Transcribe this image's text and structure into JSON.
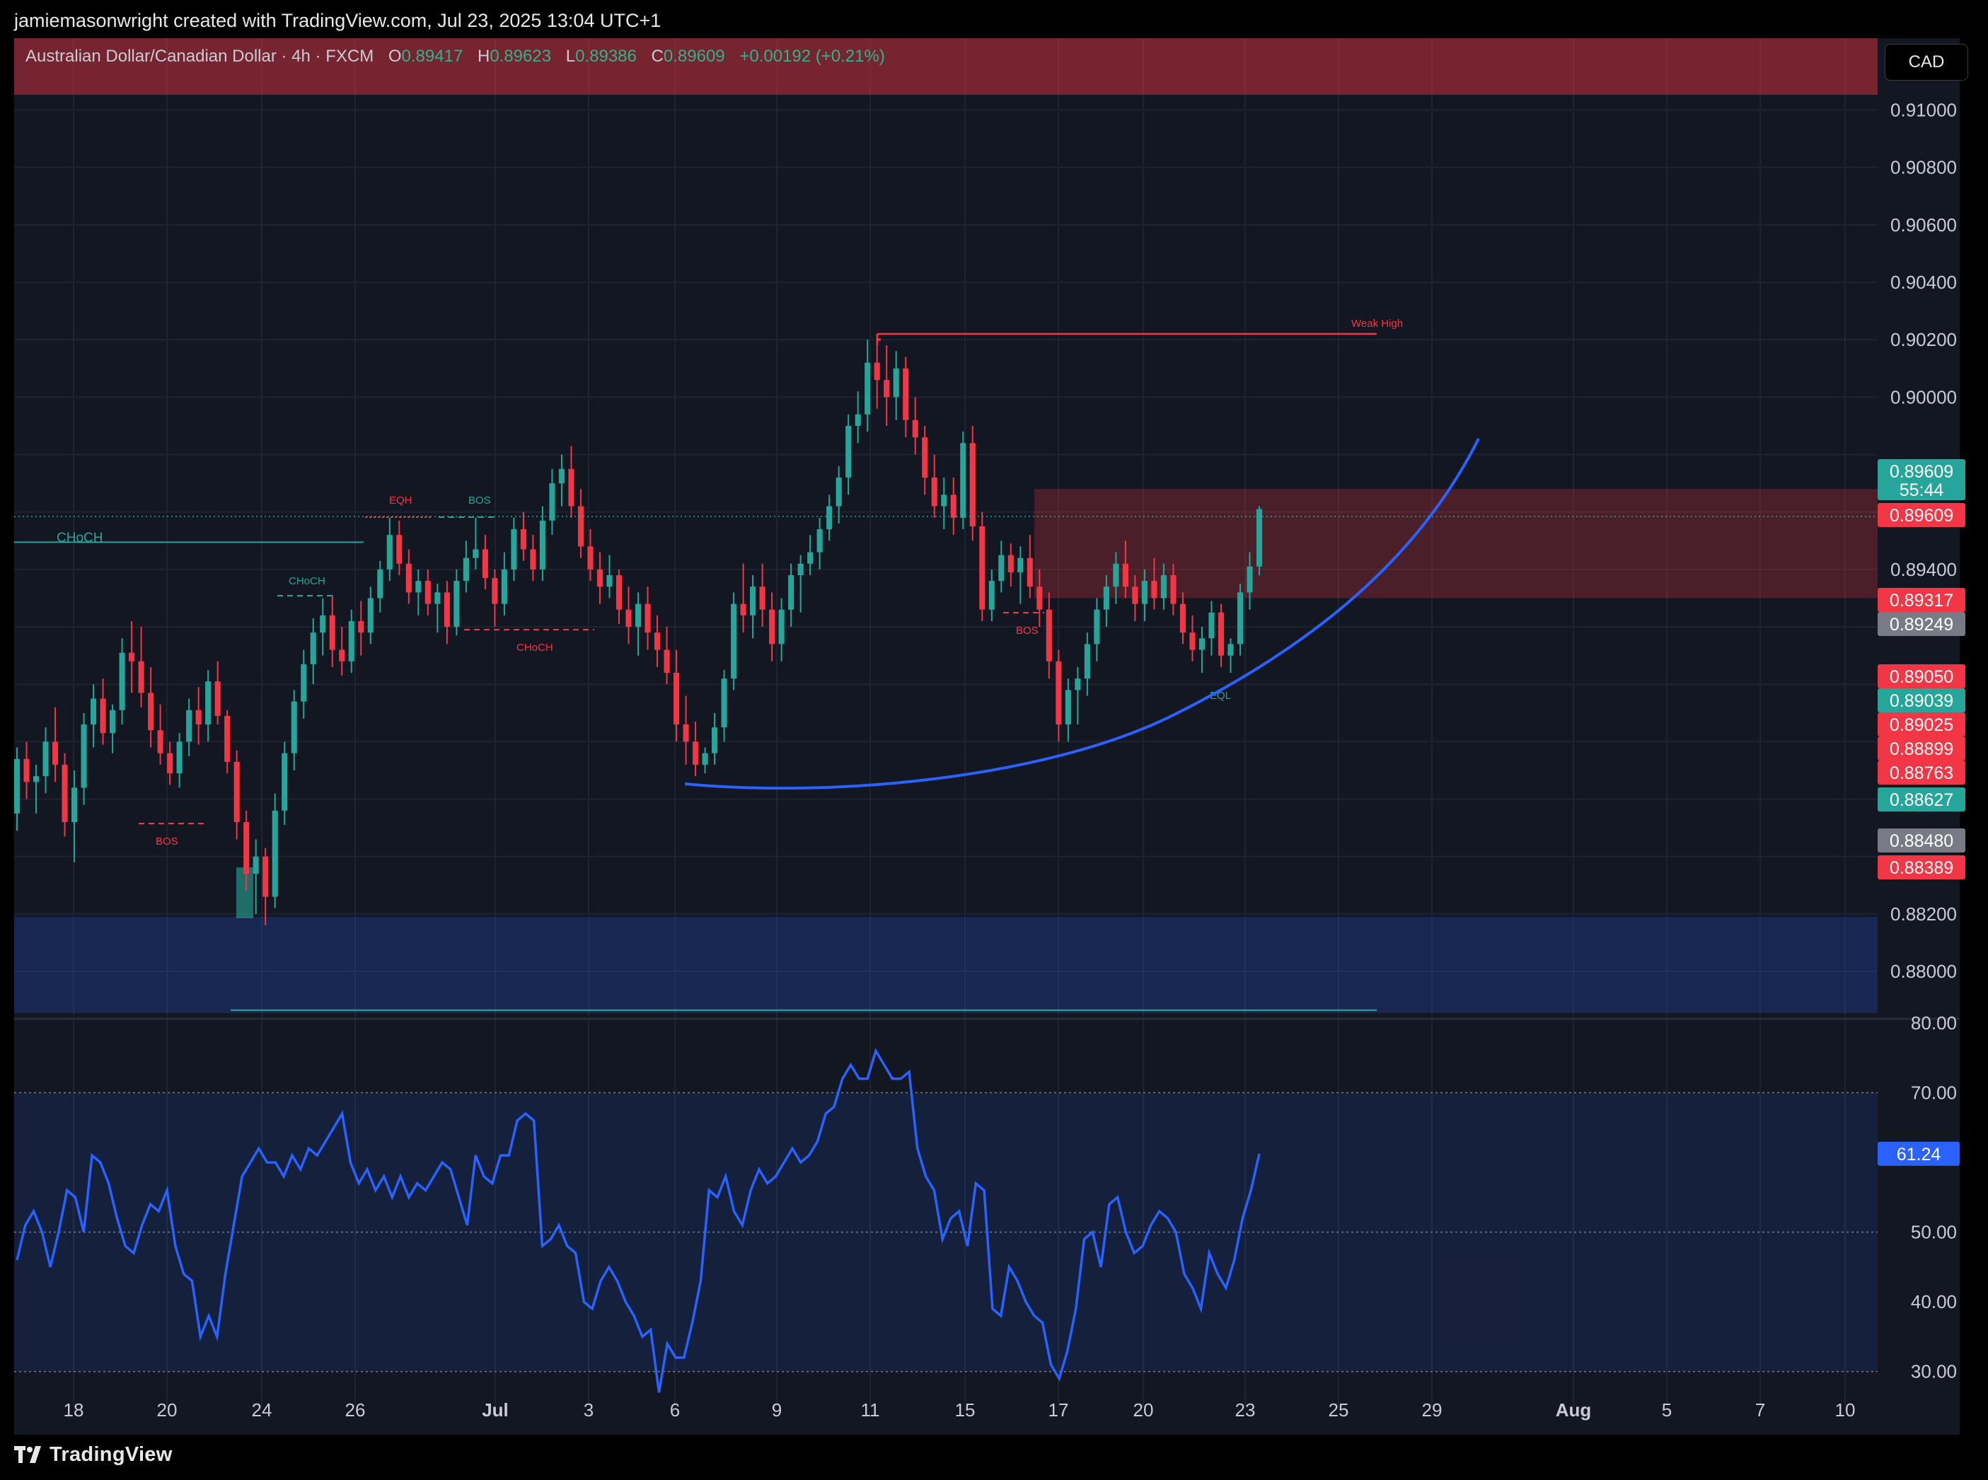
{
  "attribution": "jamiemasonwright created with TradingView.com, Jul 23, 2025 13:04 UTC+1",
  "brand": "TradingView",
  "legend": {
    "symbol": "Australian Dollar/Canadian Dollar · 4h · FXCM",
    "open_label": "O",
    "open": "0.89417",
    "high_label": "H",
    "high": "0.89623",
    "low_label": "L",
    "low": "0.89386",
    "close_label": "C",
    "close": "0.89609",
    "change": "+0.00192 (+0.21%)"
  },
  "currency_button": "CAD",
  "colors": {
    "bull": "#26a69a",
    "bear": "#f23645",
    "rsi": "#2962ff",
    "supply_zone": "#f23645",
    "demand_zone": "#2962ff",
    "background": "#131722"
  },
  "chart_data": [
    {
      "type": "candlestick",
      "symbol": "AUDCAD",
      "timeframe": "4h",
      "y_ticks": [
        "0.91000",
        "0.90800",
        "0.90600",
        "0.90400",
        "0.90200",
        "0.90000",
        "0.89400",
        "0.88200",
        "0.88000"
      ],
      "ylim": [
        0.8785,
        0.9125
      ],
      "x_ticks": [
        "18",
        "20",
        "24",
        "26",
        "Jul",
        "3",
        "6",
        "9",
        "11",
        "15",
        "17",
        "20",
        "23",
        "25",
        "29",
        "Aug",
        "5",
        "7",
        "10"
      ],
      "price_labels": [
        {
          "value": "0.89609",
          "color": "#26a69a",
          "sub": "55:44"
        },
        {
          "value": "0.89609",
          "color": "#f23645"
        },
        {
          "value": "0.89317",
          "color": "#f23645"
        },
        {
          "value": "0.89249",
          "color": "#787b86"
        },
        {
          "value": "0.89050",
          "color": "#f23645"
        },
        {
          "value": "0.89039",
          "color": "#26a69a"
        },
        {
          "value": "0.89025",
          "color": "#f23645"
        },
        {
          "value": "0.88899",
          "color": "#f23645"
        },
        {
          "value": "0.88763",
          "color": "#f23645"
        },
        {
          "value": "0.88627",
          "color": "#26a69a"
        },
        {
          "value": "0.88480",
          "color": "#787b86"
        },
        {
          "value": "0.88389",
          "color": "#f23645"
        }
      ],
      "annotations": [
        "CHoCH",
        "CHoCH",
        "EQH",
        "BOS",
        "CHoCH",
        "BOS",
        "BOS",
        "Weak High",
        "EQL"
      ],
      "zones": [
        {
          "kind": "supply",
          "from": 0.893,
          "to": 0.8968
        },
        {
          "kind": "demand",
          "from": 0.8785,
          "to": 0.882
        },
        {
          "kind": "premium",
          "from": 0.9123,
          "to": 0.9142
        }
      ],
      "lines": {
        "weak_high": 0.9022,
        "choch_level": 0.89495,
        "bottom_line": 0.87865
      },
      "candles": [
        [
          0.8855,
          0.8878,
          0.8849,
          0.8874
        ],
        [
          0.8874,
          0.888,
          0.886,
          0.8866
        ],
        [
          0.8866,
          0.8872,
          0.8855,
          0.8868
        ],
        [
          0.8868,
          0.8885,
          0.8862,
          0.888
        ],
        [
          0.888,
          0.8892,
          0.8866,
          0.8872
        ],
        [
          0.8872,
          0.8876,
          0.8847,
          0.8852
        ],
        [
          0.8852,
          0.887,
          0.8838,
          0.8864
        ],
        [
          0.8864,
          0.889,
          0.8858,
          0.8886
        ],
        [
          0.8886,
          0.89,
          0.8878,
          0.8895
        ],
        [
          0.8895,
          0.8902,
          0.8879,
          0.8883
        ],
        [
          0.8883,
          0.8893,
          0.8876,
          0.8891
        ],
        [
          0.8891,
          0.8916,
          0.8886,
          0.8911
        ],
        [
          0.8911,
          0.8922,
          0.8897,
          0.8908
        ],
        [
          0.8908,
          0.892,
          0.8892,
          0.8897
        ],
        [
          0.8897,
          0.8906,
          0.8878,
          0.8884
        ],
        [
          0.8884,
          0.8893,
          0.8872,
          0.8876
        ],
        [
          0.8876,
          0.888,
          0.8865,
          0.8869
        ],
        [
          0.8869,
          0.8883,
          0.8864,
          0.888
        ],
        [
          0.888,
          0.8895,
          0.8875,
          0.8891
        ],
        [
          0.8891,
          0.8899,
          0.8879,
          0.8886
        ],
        [
          0.8886,
          0.8905,
          0.888,
          0.8901
        ],
        [
          0.8901,
          0.8908,
          0.8886,
          0.8889
        ],
        [
          0.8889,
          0.8891,
          0.8869,
          0.8873
        ],
        [
          0.8873,
          0.8877,
          0.8846,
          0.8852
        ],
        [
          0.8852,
          0.8856,
          0.8828,
          0.8834
        ],
        [
          0.8834,
          0.8846,
          0.882,
          0.884
        ],
        [
          0.884,
          0.8843,
          0.8816,
          0.8826
        ],
        [
          0.8826,
          0.8862,
          0.8822,
          0.8856
        ],
        [
          0.8856,
          0.888,
          0.8851,
          0.8876
        ],
        [
          0.8876,
          0.8898,
          0.887,
          0.8894
        ],
        [
          0.8894,
          0.8912,
          0.8888,
          0.8907
        ],
        [
          0.8907,
          0.8923,
          0.89,
          0.8918
        ],
        [
          0.8918,
          0.893,
          0.891,
          0.8924
        ],
        [
          0.8924,
          0.8931,
          0.8906,
          0.8912
        ],
        [
          0.8912,
          0.892,
          0.8903,
          0.8908
        ],
        [
          0.8908,
          0.8926,
          0.8904,
          0.8922
        ],
        [
          0.8922,
          0.8929,
          0.891,
          0.8918
        ],
        [
          0.8918,
          0.8934,
          0.8914,
          0.893
        ],
        [
          0.893,
          0.8943,
          0.8925,
          0.894
        ],
        [
          0.894,
          0.8958,
          0.8936,
          0.8952
        ],
        [
          0.8952,
          0.8957,
          0.8938,
          0.8942
        ],
        [
          0.8942,
          0.8947,
          0.8928,
          0.8932
        ],
        [
          0.8932,
          0.894,
          0.8924,
          0.8936
        ],
        [
          0.8936,
          0.894,
          0.8924,
          0.8928
        ],
        [
          0.8928,
          0.8935,
          0.8918,
          0.8932
        ],
        [
          0.8932,
          0.8936,
          0.8914,
          0.892
        ],
        [
          0.892,
          0.894,
          0.8917,
          0.8936
        ],
        [
          0.8936,
          0.895,
          0.8932,
          0.8944
        ],
        [
          0.8944,
          0.8958,
          0.894,
          0.8947
        ],
        [
          0.8947,
          0.8952,
          0.8933,
          0.8937
        ],
        [
          0.8937,
          0.894,
          0.892,
          0.8928
        ],
        [
          0.8928,
          0.8946,
          0.8924,
          0.894
        ],
        [
          0.894,
          0.8958,
          0.8936,
          0.8954
        ],
        [
          0.8954,
          0.896,
          0.8943,
          0.8947
        ],
        [
          0.8947,
          0.8952,
          0.8936,
          0.894
        ],
        [
          0.894,
          0.8962,
          0.8936,
          0.8957
        ],
        [
          0.8957,
          0.8975,
          0.8952,
          0.897
        ],
        [
          0.897,
          0.898,
          0.8962,
          0.8975
        ],
        [
          0.8975,
          0.8983,
          0.8958,
          0.8962
        ],
        [
          0.8962,
          0.8968,
          0.8944,
          0.8948
        ],
        [
          0.8948,
          0.8954,
          0.8936,
          0.894
        ],
        [
          0.894,
          0.8946,
          0.8928,
          0.8934
        ],
        [
          0.8934,
          0.8945,
          0.893,
          0.8938
        ],
        [
          0.8938,
          0.894,
          0.8921,
          0.8926
        ],
        [
          0.8926,
          0.8934,
          0.8914,
          0.892
        ],
        [
          0.892,
          0.8932,
          0.891,
          0.8928
        ],
        [
          0.8928,
          0.8934,
          0.8912,
          0.8918
        ],
        [
          0.8918,
          0.8924,
          0.8906,
          0.8912
        ],
        [
          0.8912,
          0.892,
          0.89,
          0.8904
        ],
        [
          0.8904,
          0.8912,
          0.888,
          0.8886
        ],
        [
          0.8886,
          0.8896,
          0.8872,
          0.888
        ],
        [
          0.888,
          0.8887,
          0.8868,
          0.8872
        ],
        [
          0.8872,
          0.8878,
          0.8869,
          0.8876
        ],
        [
          0.8876,
          0.889,
          0.8872,
          0.8885
        ],
        [
          0.8885,
          0.8905,
          0.888,
          0.8902
        ],
        [
          0.8902,
          0.8932,
          0.8898,
          0.8928
        ],
        [
          0.8928,
          0.8942,
          0.8918,
          0.8924
        ],
        [
          0.8924,
          0.8938,
          0.8916,
          0.8934
        ],
        [
          0.8934,
          0.8942,
          0.892,
          0.8926
        ],
        [
          0.8926,
          0.8932,
          0.8908,
          0.8914
        ],
        [
          0.8914,
          0.893,
          0.8908,
          0.8926
        ],
        [
          0.8926,
          0.8942,
          0.892,
          0.8938
        ],
        [
          0.8938,
          0.8945,
          0.8925,
          0.8942
        ],
        [
          0.8942,
          0.8952,
          0.8938,
          0.8946
        ],
        [
          0.8946,
          0.8958,
          0.894,
          0.8954
        ],
        [
          0.8954,
          0.8966,
          0.895,
          0.8962
        ],
        [
          0.8962,
          0.8976,
          0.8956,
          0.8972
        ],
        [
          0.8972,
          0.8994,
          0.8966,
          0.899
        ],
        [
          0.899,
          0.9002,
          0.8984,
          0.8994
        ],
        [
          0.8994,
          0.902,
          0.8988,
          0.9012
        ],
        [
          0.9012,
          0.9022,
          0.8996,
          0.9006
        ],
        [
          0.9006,
          0.9018,
          0.899,
          0.9
        ],
        [
          0.9,
          0.9016,
          0.8992,
          0.901
        ],
        [
          0.901,
          0.9014,
          0.8986,
          0.8992
        ],
        [
          0.8992,
          0.9,
          0.898,
          0.8986
        ],
        [
          0.8986,
          0.899,
          0.8966,
          0.8972
        ],
        [
          0.8972,
          0.898,
          0.8958,
          0.8962
        ],
        [
          0.8962,
          0.8972,
          0.8954,
          0.8966
        ],
        [
          0.8966,
          0.8972,
          0.8952,
          0.8958
        ],
        [
          0.8958,
          0.8988,
          0.8954,
          0.8984
        ],
        [
          0.8984,
          0.899,
          0.895,
          0.8955
        ],
        [
          0.8955,
          0.896,
          0.8922,
          0.8926
        ],
        [
          0.8926,
          0.894,
          0.8922,
          0.8936
        ],
        [
          0.8936,
          0.895,
          0.8932,
          0.8945
        ],
        [
          0.8945,
          0.8949,
          0.8934,
          0.8939
        ],
        [
          0.8939,
          0.8948,
          0.8928,
          0.8944
        ],
        [
          0.8944,
          0.8952,
          0.893,
          0.8934
        ],
        [
          0.8934,
          0.894,
          0.892,
          0.8926
        ],
        [
          0.8926,
          0.8932,
          0.8902,
          0.8908
        ],
        [
          0.8908,
          0.8912,
          0.888,
          0.8886
        ],
        [
          0.8886,
          0.8902,
          0.888,
          0.8898
        ],
        [
          0.8898,
          0.8906,
          0.8886,
          0.8902
        ],
        [
          0.8902,
          0.8918,
          0.8896,
          0.8914
        ],
        [
          0.8914,
          0.893,
          0.8908,
          0.8926
        ],
        [
          0.8926,
          0.8938,
          0.892,
          0.8934
        ],
        [
          0.8934,
          0.8946,
          0.8928,
          0.8942
        ],
        [
          0.8942,
          0.895,
          0.893,
          0.8934
        ],
        [
          0.8934,
          0.8938,
          0.8922,
          0.8928
        ],
        [
          0.8928,
          0.894,
          0.8922,
          0.8936
        ],
        [
          0.8936,
          0.8944,
          0.8926,
          0.893
        ],
        [
          0.893,
          0.8942,
          0.8926,
          0.8938
        ],
        [
          0.8938,
          0.8942,
          0.8924,
          0.8928
        ],
        [
          0.8928,
          0.8932,
          0.8914,
          0.8918
        ],
        [
          0.8918,
          0.8924,
          0.8908,
          0.8912
        ],
        [
          0.8912,
          0.892,
          0.8904,
          0.8916
        ],
        [
          0.8916,
          0.8929,
          0.891,
          0.8925
        ],
        [
          0.8925,
          0.8928,
          0.8906,
          0.891
        ],
        [
          0.891,
          0.8916,
          0.8904,
          0.8914
        ],
        [
          0.8914,
          0.8935,
          0.891,
          0.8932
        ],
        [
          0.8932,
          0.8946,
          0.8926,
          0.8941
        ],
        [
          0.8941,
          0.8962,
          0.8938,
          0.8961
        ]
      ]
    },
    {
      "type": "line",
      "name": "RSI",
      "ylim": [
        25,
        80
      ],
      "y_ticks": [
        "80.00",
        "70.00",
        "60.00",
        "50.00",
        "40.00",
        "30.00"
      ],
      "bands": [
        30,
        70
      ],
      "current_value": "61.24",
      "values": [
        46,
        51,
        53,
        50,
        45,
        50,
        56,
        55,
        50,
        61,
        60,
        57,
        52,
        48,
        47,
        51,
        54,
        53,
        56,
        48,
        44,
        43,
        35,
        38,
        35,
        44,
        51,
        58,
        60,
        62,
        60,
        60,
        58,
        61,
        59,
        62,
        61,
        63,
        65,
        67,
        60,
        57,
        59,
        56,
        58,
        55,
        58,
        55,
        57,
        56,
        58,
        60,
        59,
        55,
        51,
        61,
        58,
        57,
        61,
        61,
        66,
        67,
        66,
        48,
        49,
        51,
        48,
        47,
        40,
        39,
        43,
        45,
        43,
        40,
        38,
        35,
        36,
        27,
        34,
        32,
        32,
        37,
        43,
        56,
        55,
        58,
        53,
        51,
        56,
        59,
        57,
        58,
        60,
        62,
        60,
        61,
        63,
        67,
        68,
        72,
        74,
        72,
        72,
        76,
        74,
        72,
        72,
        73,
        62,
        58,
        56,
        49,
        52,
        53,
        48,
        57,
        56,
        39,
        38,
        45,
        43,
        40,
        38,
        37,
        31,
        29,
        33,
        39,
        49,
        50,
        45,
        54,
        55,
        50,
        47,
        48,
        51,
        53,
        52,
        50,
        44,
        42,
        39,
        47,
        44,
        42,
        46,
        52,
        56,
        61.24
      ]
    }
  ]
}
